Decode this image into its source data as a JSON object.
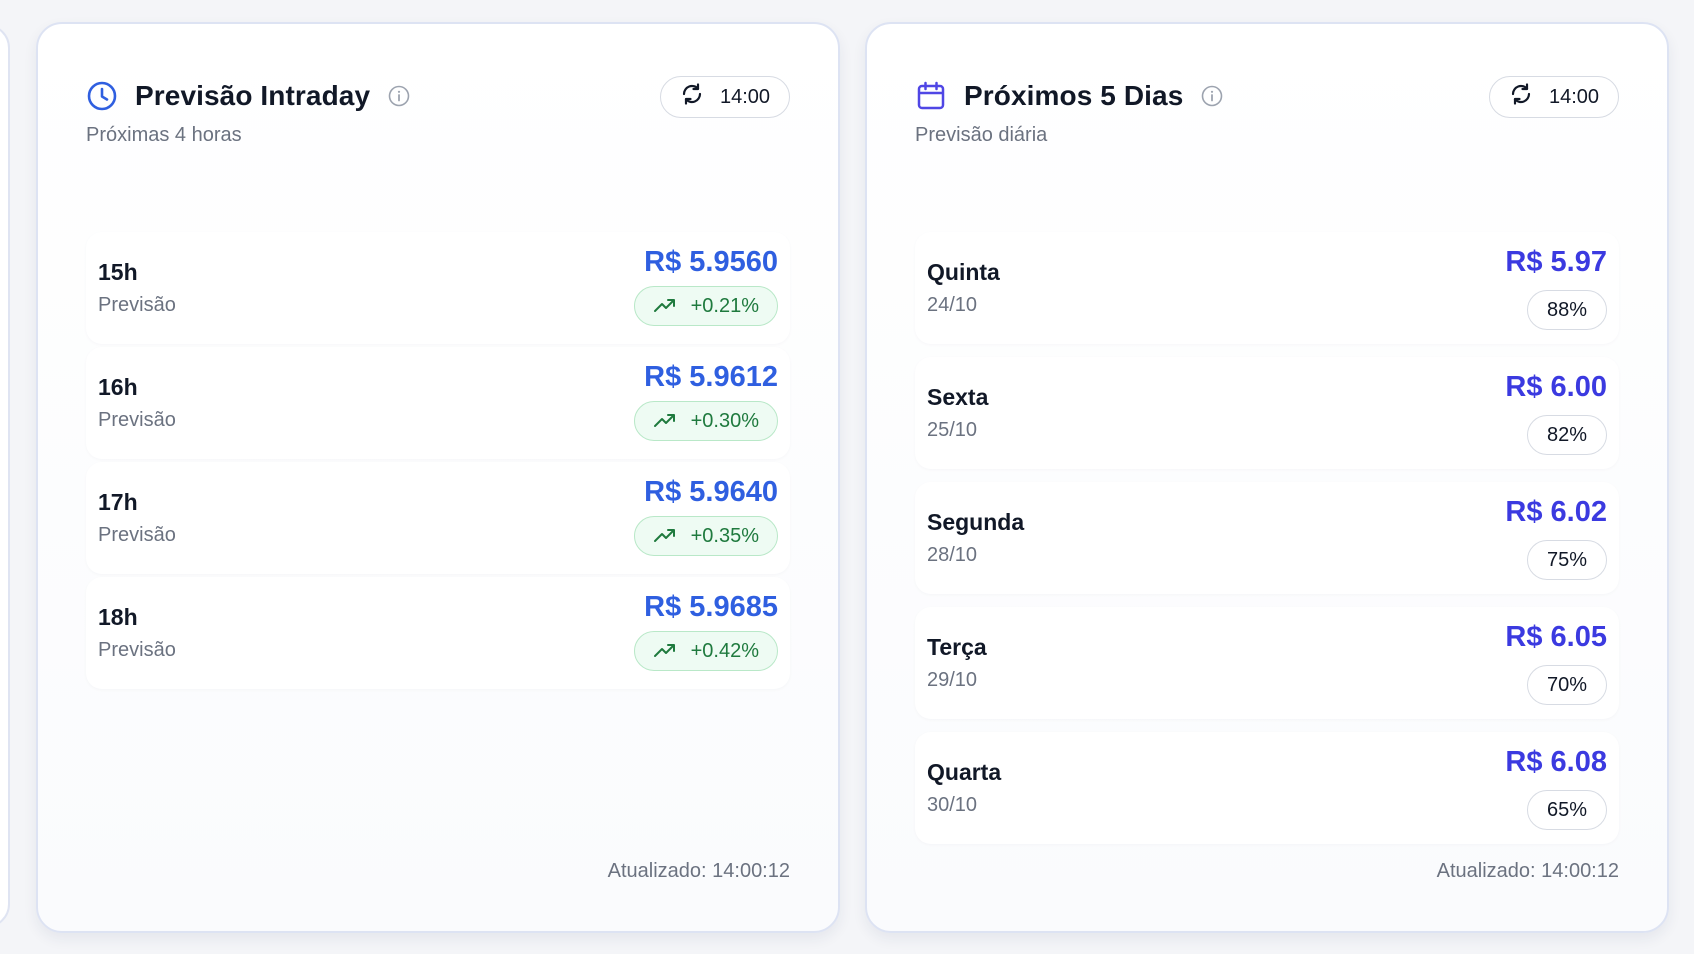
{
  "intraday": {
    "title": "Previsão Intraday",
    "subtitle": "Próximas 4 horas",
    "time": "14:00",
    "updated": "Atualizado: 14:00:12",
    "rows": [
      {
        "label": "15h",
        "sub": "Previsão",
        "price": "R$ 5.9560",
        "change": "+0.21%"
      },
      {
        "label": "16h",
        "sub": "Previsão",
        "price": "R$ 5.9612",
        "change": "+0.30%"
      },
      {
        "label": "17h",
        "sub": "Previsão",
        "price": "R$ 5.9640",
        "change": "+0.35%"
      },
      {
        "label": "18h",
        "sub": "Previsão",
        "price": "R$ 5.9685",
        "change": "+0.42%"
      }
    ]
  },
  "daily": {
    "title": "Próximos 5 Dias",
    "subtitle": "Previsão diária",
    "time": "14:00",
    "updated": "Atualizado: 14:00:12",
    "rows": [
      {
        "day": "Quinta",
        "date": "24/10",
        "price": "R$ 5.97",
        "confidence": "88%"
      },
      {
        "day": "Sexta",
        "date": "25/10",
        "price": "R$ 6.00",
        "confidence": "82%"
      },
      {
        "day": "Segunda",
        "date": "28/10",
        "price": "R$ 6.02",
        "confidence": "75%"
      },
      {
        "day": "Terça",
        "date": "29/10",
        "price": "R$ 6.05",
        "confidence": "70%"
      },
      {
        "day": "Quarta",
        "date": "30/10",
        "price": "R$ 6.08",
        "confidence": "65%"
      }
    ]
  },
  "icons": {
    "intraday": "clock-icon",
    "daily": "calendar-icon",
    "info": "info-icon",
    "refresh": "refresh-icon",
    "trend": "trending-up-icon"
  },
  "colors": {
    "intraday_accent": "#2f5fe0",
    "daily_accent": "#4f46e5",
    "positive": "#1f7a3e"
  }
}
